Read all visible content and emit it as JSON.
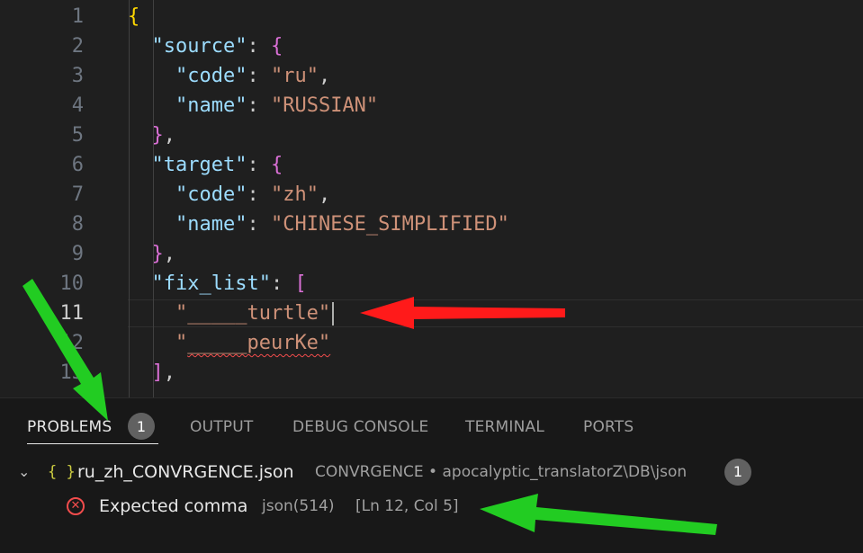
{
  "editor": {
    "line_numbers": [
      "1",
      "2",
      "3",
      "4",
      "5",
      "6",
      "7",
      "8",
      "9",
      "10",
      "11",
      "12",
      "13"
    ],
    "lines": [
      {
        "indent": "",
        "tokens": [
          {
            "t": "{",
            "c": "b1"
          }
        ]
      },
      {
        "indent": "  ",
        "tokens": [
          {
            "t": "\"source\"",
            "c": "k"
          },
          {
            "t": ": ",
            "c": "p"
          },
          {
            "t": "{",
            "c": "b2"
          }
        ]
      },
      {
        "indent": "    ",
        "tokens": [
          {
            "t": "\"code\"",
            "c": "k"
          },
          {
            "t": ": ",
            "c": "p"
          },
          {
            "t": "\"ru\"",
            "c": "s"
          },
          {
            "t": ",",
            "c": "p"
          }
        ]
      },
      {
        "indent": "    ",
        "tokens": [
          {
            "t": "\"name\"",
            "c": "k"
          },
          {
            "t": ": ",
            "c": "p"
          },
          {
            "t": "\"RUSSIAN\"",
            "c": "s"
          }
        ]
      },
      {
        "indent": "  ",
        "tokens": [
          {
            "t": "}",
            "c": "b2"
          },
          {
            "t": ",",
            "c": "p"
          }
        ]
      },
      {
        "indent": "  ",
        "tokens": [
          {
            "t": "\"target\"",
            "c": "k"
          },
          {
            "t": ": ",
            "c": "p"
          },
          {
            "t": "{",
            "c": "b2"
          }
        ]
      },
      {
        "indent": "    ",
        "tokens": [
          {
            "t": "\"code\"",
            "c": "k"
          },
          {
            "t": ": ",
            "c": "p"
          },
          {
            "t": "\"zh\"",
            "c": "s"
          },
          {
            "t": ",",
            "c": "p"
          }
        ]
      },
      {
        "indent": "    ",
        "tokens": [
          {
            "t": "\"name\"",
            "c": "k"
          },
          {
            "t": ": ",
            "c": "p"
          },
          {
            "t": "\"CHINESE_SIMPLIFIED\"",
            "c": "s"
          }
        ]
      },
      {
        "indent": "  ",
        "tokens": [
          {
            "t": "}",
            "c": "b2"
          },
          {
            "t": ",",
            "c": "p"
          }
        ]
      },
      {
        "indent": "  ",
        "tokens": [
          {
            "t": "\"fix_list\"",
            "c": "k"
          },
          {
            "t": ": ",
            "c": "p"
          },
          {
            "t": "[",
            "c": "b2"
          }
        ]
      },
      {
        "indent": "    ",
        "tokens": [
          {
            "t": "\"_____turtle\"",
            "c": "s"
          }
        ]
      },
      {
        "indent": "    ",
        "tokens": [
          {
            "t": "\"",
            "c": "s"
          },
          {
            "t": "_____peurKe\"",
            "c": "s",
            "err": true
          }
        ]
      },
      {
        "indent": "  ",
        "tokens": [
          {
            "t": "]",
            "c": "b2"
          },
          {
            "t": ",",
            "c": "p"
          }
        ]
      }
    ],
    "active_line": 11
  },
  "panel": {
    "tabs": [
      {
        "label": "PROBLEMS",
        "active": true
      },
      {
        "label": "OUTPUT",
        "active": false
      },
      {
        "label": "DEBUG CONSOLE",
        "active": false
      },
      {
        "label": "TERMINAL",
        "active": false
      },
      {
        "label": "PORTS",
        "active": false
      }
    ],
    "problems_count": "1",
    "file": {
      "chevron": "chevron-down-icon",
      "icon_text": "{ }",
      "name": "ru_zh_CONVRGENCE.json",
      "path": "CONVRGENCE • apocalyptic_translatorZ\\DB\\json",
      "count": "1"
    },
    "problem": {
      "icon": "error-icon",
      "message": "Expected comma",
      "source": "json(514)",
      "location": "[Ln 12, Col 5]"
    }
  },
  "colors": {
    "red_arrow": "#ff1a1a",
    "green_arrow": "#22cc22",
    "error": "#f14c4c"
  }
}
